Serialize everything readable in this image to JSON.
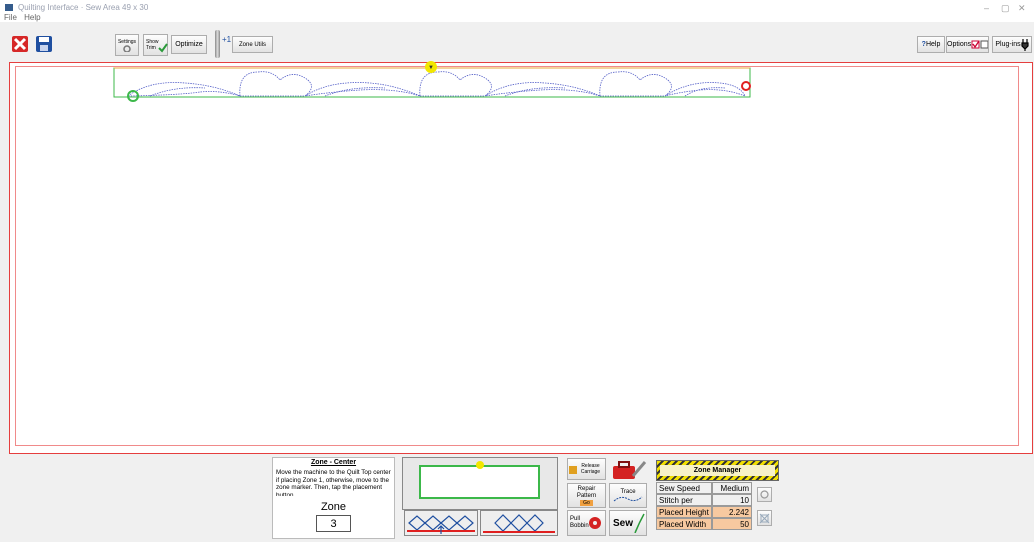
{
  "window": {
    "title": "Quilting Interface  ·  Sew Area 49 x 30",
    "menu": [
      "File",
      "Help"
    ],
    "controls": [
      "–",
      "▢",
      "✕"
    ]
  },
  "toolbar": {
    "settings_label": "Settings",
    "show_trim_label": "Show Trim",
    "optimize_label": "Optimize",
    "plus_one_label": "+1",
    "zone_utils_label": "Zone Utils",
    "help_label": "Help",
    "options_label": "Options",
    "plugins_label": "Plug-ins"
  },
  "zone_panel": {
    "heading": "Zone - Center",
    "instructions": "Move the machine to the Quilt Top center if placing Zone 1, otherwise, move to the zone marker. Then, tap the placement button.",
    "zone_label": "Zone",
    "zone_value": "3"
  },
  "actions": {
    "release_carriage": "Release Carriage",
    "repair_pattern": "Repair Pattern",
    "repair_pattern_sub": "Go",
    "trace": "Trace",
    "pull_bobbin": "Pull Bobbin",
    "sew": "Sew"
  },
  "zone_manager": {
    "title": "Zone Manager",
    "rows": [
      {
        "label": "Sew Speed",
        "value": "Medium"
      },
      {
        "label": "Stitch per Inch",
        "value": "10"
      },
      {
        "label": "Placed Height",
        "value": "2.242"
      },
      {
        "label": "Placed Width",
        "value": "50"
      }
    ]
  },
  "colors": {
    "border_red": "#e53e3e",
    "zone_green": "#3cb84a",
    "pattern_blue": "#5560c8",
    "marker_yellow": "#f2e600",
    "end_red": "#e02020",
    "orange_cell": "#f7c9a0"
  }
}
